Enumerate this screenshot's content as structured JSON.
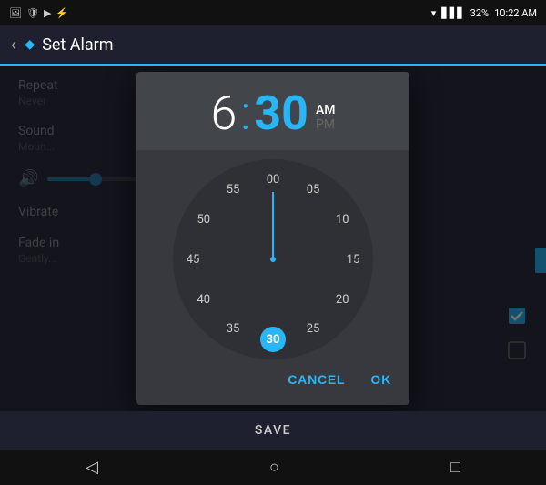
{
  "statusBar": {
    "battery": "32%",
    "time": "10:22 AM",
    "icons": [
      "picture",
      "shield",
      "play",
      "lightning"
    ]
  },
  "titleBar": {
    "back": "‹",
    "diamond": "◆",
    "title": "Set Alarm"
  },
  "dialog": {
    "hours": "6",
    "colon": ":",
    "minutes": "30",
    "amActive": "AM",
    "amInactive": "PM",
    "numbers": [
      {
        "label": "00",
        "angle": 0,
        "r": 88
      },
      {
        "label": "05",
        "angle": 30,
        "r": 88
      },
      {
        "label": "10",
        "angle": 60,
        "r": 88
      },
      {
        "label": "15",
        "angle": 90,
        "r": 88
      },
      {
        "label": "20",
        "angle": 120,
        "r": 88
      },
      {
        "label": "25",
        "angle": 150,
        "r": 88
      },
      {
        "label": "30",
        "angle": 180,
        "r": 88,
        "selected": true
      },
      {
        "label": "35",
        "angle": 210,
        "r": 88
      },
      {
        "label": "40",
        "angle": 240,
        "r": 88
      },
      {
        "label": "45",
        "angle": 270,
        "r": 88
      },
      {
        "label": "50",
        "angle": 300,
        "r": 88
      },
      {
        "label": "55",
        "angle": 330,
        "r": 88
      }
    ],
    "cancelLabel": "CANCEL",
    "okLabel": "OK"
  },
  "settings": {
    "repeat": {
      "label": "Repeat",
      "sub": "Never"
    },
    "sound": {
      "label": "Sound",
      "sub": "Moun..."
    },
    "vibrate": {
      "label": "Vibrate"
    },
    "fade": {
      "label": "Fade in",
      "sub": "Gently..."
    }
  },
  "saveBar": {
    "label": "SAVE"
  },
  "navBar": {
    "back": "◁",
    "home": "○",
    "recent": "□"
  }
}
